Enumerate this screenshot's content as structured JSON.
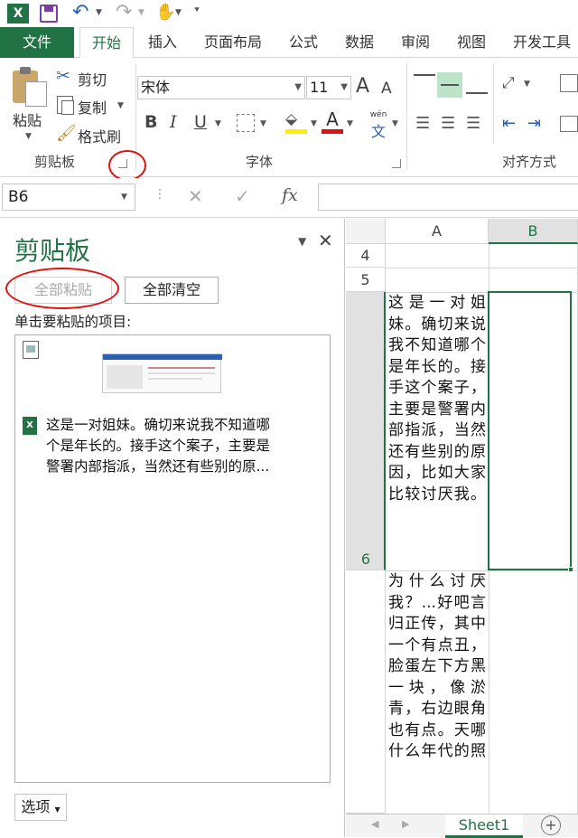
{
  "qat": {
    "app_icon": "excel-icon",
    "save_icon": "save-icon",
    "undo_icon": "undo-icon",
    "redo_icon": "redo-icon",
    "touch_icon": "touch-mode-icon",
    "customize_icon": "chevron-down-icon"
  },
  "tabs": [
    "文件",
    "开始",
    "插入",
    "页面布局",
    "公式",
    "数据",
    "审阅",
    "视图",
    "开发工具"
  ],
  "ribbon": {
    "clipboard": {
      "paste": "粘贴",
      "cut": "剪切",
      "copy": "复制",
      "format_painter": "格式刷",
      "label": "剪贴板"
    },
    "font": {
      "name": "宋体",
      "size": "11",
      "bold": "B",
      "italic": "I",
      "underline": "U",
      "font_color": "A",
      "phonetic": "wén",
      "phonetic_char": "文",
      "label": "字体"
    },
    "alignment": {
      "label": "对齐方式"
    }
  },
  "formula_bar": {
    "name_box": "B6",
    "cancel": "✕",
    "enter": "✓",
    "fx": "fx"
  },
  "clipboard_pane": {
    "title": "剪贴板",
    "paste_all": "全部粘贴",
    "clear_all": "全部清空",
    "instruction": "单击要粘贴的项目:",
    "item_text_line1": "这是一对姐妹。确切来说我不知道哪",
    "item_text_line2": "个是年长的。接手这个案子，主要是",
    "item_text_line3": "警署内部指派，当然还有些别的原...",
    "options": "选项"
  },
  "grid": {
    "col_a": "A",
    "col_b": "B",
    "row4": "4",
    "row5": "5",
    "row6": "6",
    "cell_a6": "这是一对姐妹。确切来说我不知道哪个是年长的。接手这个案子，主要是警署内部指派，当然还有些别的原因，比如大家比较讨厌我。",
    "cell_a7": "为什么讨厌我？...好吧言归正传，其中一个有点丑，脸蛋左下方黑一块，像淤青，右边眼角也有点。天哪什么年代的照",
    "sheet_tab": "Sheet1",
    "add_sheet": "+"
  },
  "colors": {
    "accent": "#217346",
    "highlight": "#e01010"
  }
}
